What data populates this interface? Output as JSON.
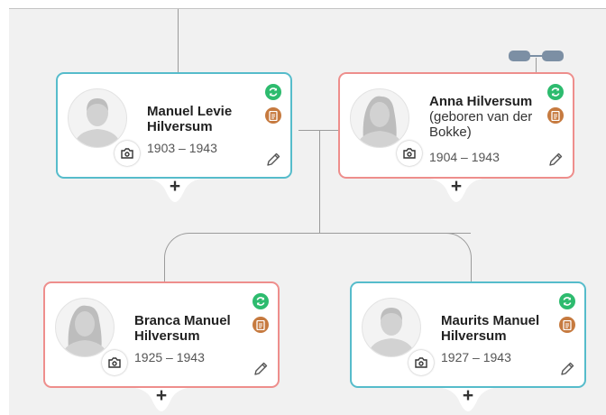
{
  "people": [
    {
      "name": "Manuel Levie Hilversum",
      "birth_name": "",
      "dates": "1903 – 1943",
      "gender": "male"
    },
    {
      "name": "Anna Hilversum",
      "birth_name": "(geboren van der Bokke)",
      "dates": "1904 – 1943",
      "gender": "female"
    },
    {
      "name": "Branca Manuel Hilversum",
      "birth_name": "",
      "dates": "1925 – 1943",
      "gender": "female"
    },
    {
      "name": "Maurits Manuel Hilversum",
      "birth_name": "",
      "dates": "1927 – 1943",
      "gender": "male"
    }
  ],
  "controls": {
    "expand_label": "+"
  },
  "icons": {
    "sync": "sync-icon",
    "document": "document-icon",
    "camera": "camera-icon",
    "edit": "pencil-icon",
    "partner_link": "partner-link-icon"
  },
  "colors": {
    "male_border": "#56bccb",
    "female_border": "#ee8e8c",
    "sync_badge": "#2dbb6e",
    "document_badge": "#c67a3f",
    "canvas_background": "#f1f1f1",
    "connector": "#9b9b9b"
  }
}
